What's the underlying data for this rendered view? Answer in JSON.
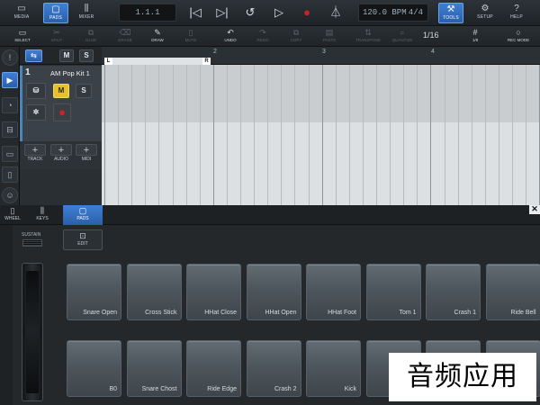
{
  "toolbar": {
    "media": "MEDIA",
    "pads": "PADS",
    "mixer": "MIXER",
    "position": "1.1.1",
    "tempo": "120.0 BPM",
    "signature": "4/4",
    "tools": "TOOLS",
    "setup": "SETUP",
    "help": "HELP"
  },
  "editbar": {
    "select": "SELECT",
    "split": "SPLIT",
    "glue": "GLUE",
    "erase": "ERASE",
    "draw": "DRAW",
    "mute": "MUTE",
    "undo": "UNDO",
    "redo": "REDO",
    "copy": "COPY",
    "paste": "PASTE",
    "transpose": "TRANSPOSE",
    "quantize": "QUANTIZE",
    "quantize_value": "1/16",
    "grid": "1/8",
    "rec_mode": "REC MODE"
  },
  "track_panel": {
    "m": "M",
    "s": "S",
    "track_number": "1",
    "track_name": "AM Pop Kit 1",
    "track": "TRACK",
    "audio": "AUDIO",
    "midi": "MIDI"
  },
  "timeline": {
    "ruler": [
      "2",
      "3",
      "4"
    ],
    "loop_left": "L",
    "loop_right": "R"
  },
  "pad_area": {
    "tabs": [
      "WHEEL",
      "KEYS",
      "PADS"
    ],
    "edit": "EDIT",
    "sustain": "SUSTAIN",
    "pads_row1": [
      "Snare Open",
      "Cross Stick",
      "HHat Close",
      "HHat Open",
      "HHat Foot",
      "Tom 1",
      "Crash 1",
      "Ride Bell"
    ],
    "pads_row2": [
      "B0",
      "Snare Chost",
      "Ride Edge",
      "Crash 2",
      "Kick",
      "",
      "",
      ""
    ]
  },
  "watermark": "音频应用",
  "colors": {
    "accent": "#3f7fd6",
    "record": "#d0202a",
    "mute_yellow": "#e7c12b"
  }
}
